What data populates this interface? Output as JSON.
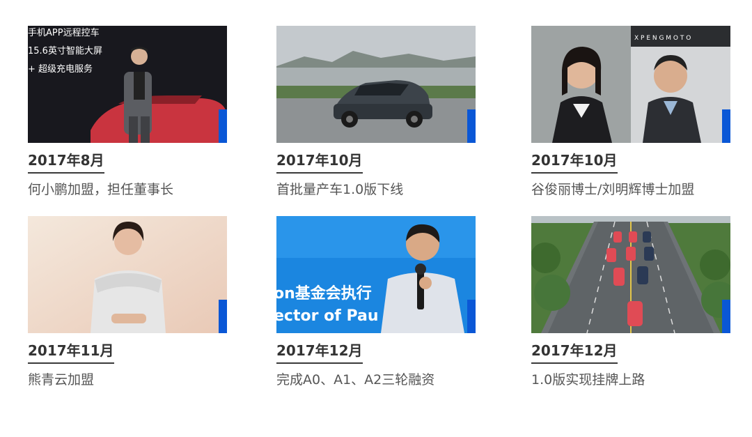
{
  "items": [
    {
      "date": "2017年8月",
      "desc": "何小鹏加盟，担任董事长",
      "photo_lines": [
        "手机APP远程控车",
        "15.6英寸智能大屏",
        "+ 超级充电服务"
      ]
    },
    {
      "date": "2017年10月",
      "desc": "首批量产车1.0版下线"
    },
    {
      "date": "2017年10月",
      "desc": "谷俊丽博士/刘明辉博士加盟",
      "photo_text": "X P E N G   M O T O"
    },
    {
      "date": "2017年11月",
      "desc": "熊青云加盟"
    },
    {
      "date": "2017年12月",
      "desc": "完成A0、A1、A2三轮融资",
      "photo_lines": [
        "on基金会执行",
        "ector of Pau"
      ]
    },
    {
      "date": "2017年12月",
      "desc": "1.0版实现挂牌上路"
    }
  ],
  "colors": {
    "accent": "#0a57d6",
    "date_text": "#333333",
    "desc_text": "#555555"
  }
}
